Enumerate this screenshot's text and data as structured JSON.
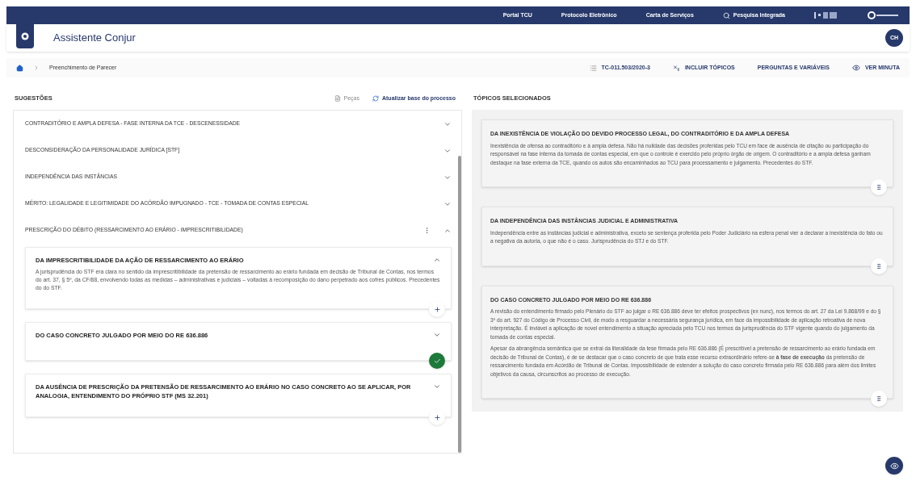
{
  "top_bar": {
    "links": [
      "Portal TCU",
      "Protocolo Eletrônico",
      "Carta de Serviços",
      "Pesquisa Integrada"
    ]
  },
  "header": {
    "title": "Assistente Conjur",
    "avatar": "CH"
  },
  "breadcrumb": {
    "items": [
      "Preenchimento de Parecer"
    ]
  },
  "toolbar": {
    "process": "TC-011.503/2020-3",
    "actions": [
      "INCLUIR TÓPICOS",
      "PERGUNTAS E VARIÁVEIS",
      "VER MINUTA"
    ]
  },
  "suggestions": {
    "title": "SUGESTÕES",
    "pieces": "Peças",
    "refresh": "Atualizar base do processo",
    "items": [
      {
        "label": "CONTRADITÓRIO E AMPLA DEFESA - FASE INTERNA DA TCE - DESCENESSIDADE",
        "expanded": false
      },
      {
        "label": "DESCONSIDERAÇÃO DA PERSONALIDADE JURÍDICA [STF]",
        "expanded": false
      },
      {
        "label": "INDEPENDÊNCIA DAS INSTÂNCIAS",
        "expanded": false
      },
      {
        "label": "MÉRITO: LEGALIDADE E LEGITIMIDADE DO ACÓRDÃO IMPUGNADO - TCE - TOMADA DE CONTAS ESPECIAL",
        "expanded": false
      },
      {
        "label": "PRESCRIÇÃO DO DÉBITO (RESSARCIMENTO AO ERÁRIO - IMPRESCRITIBILIDADE)",
        "expanded": true,
        "cards": [
          {
            "title": "DA IMPRESCRITIBILIDADE DA AÇÃO DE RESSARCIMENTO AO ERÁRIO",
            "expanded": true,
            "added": false,
            "text": "A jurisprudência do STF era clara no sentido da imprescritibilidade da pretensão de ressarcimento ao erário fundada em decisão de Tribunal de Contas, nos termos do art. 37, § 5º, da CF/88, envolvendo todas as medidas – administrativas e judiciais – voltadas à recomposição do dano perpetrado aos cofres públicos. Precedentes do do STF."
          },
          {
            "title": "DO CASO CONCRETO JULGADO POR MEIO DO RE 636.886",
            "expanded": false,
            "added": true
          },
          {
            "title": "DA AUSÊNCIA DE PRESCRIÇÃO DA PRETENSÃO DE RESSARCIMENTO AO ERÁRIO NO CASO CONCRETO AO SE APLICAR, POR ANALOGIA, ENTENDIMENTO DO PRÓPRIO STF (MS 32.201)",
            "expanded": false,
            "added": false
          }
        ]
      }
    ]
  },
  "selected_topics": {
    "title": "TÓPICOS SELECIONADOS",
    "cards": [
      {
        "title": "DA INEXISTÊNCIA DE VIOLAÇÃO DO DEVIDO PROCESSO LEGAL, DO CONTRADITÓRIO E DA AMPLA DEFESA",
        "paragraphs": [
          "Inexistência de ofensa ao contraditório e à ampla defesa. Não há nulidade das decisões proferidas pelo TCU em face de ausência de citação ou participação do responsável na fase interna da tomada de contas especial, em que o controle é exercido pelo próprio órgão de origem. O contraditório e a ampla defesa ganham destaque na fase externa da TCE, quando os autos são encaminhados ao TCU para processamento e julgamento. Precedentes do STF."
        ]
      },
      {
        "title": "DA INDEPENDÊNCIA DAS INSTÂNCIAS JUDICIAL E ADMINISTRATIVA",
        "paragraphs": [
          "Independência entre as instâncias judicial e administrativa, exceto se sentença proferida pelo Poder Judiciário na esfera penal vier a declarar a inexistência do fato ou a negativa da autoria, o que não é o caso. Jurisprudência do STJ e do STF."
        ]
      },
      {
        "title": "DO CASO CONCRETO JULGADO POR MEIO DO RE 636.886",
        "paragraphs": [
          "A revisão do entendimento firmado pelo Plenário do STF ao julgar o RE 636.886 deve ter efeitos prospectivos (ex nunc), nos termos do art. 27 da Lei 9.868/99 e do § 3º do art. 927 do Código de Processo Civil, de modo a resguardar a necessária segurança jurídica, em face da impossibilidade de aplicação retroativa de nova interpretação. É inviável a aplicação de novel entendimento a situação apreciada pelo TCU nos termos da jurisprudência do STF vigente quando do julgamento da tomada de contas especial.",
          "Apesar da abrangência semântica que se extrai da literalidade da tese firmada pelo RE 636.886 (É prescritível a pretensão de ressarcimento ao erário fundada em decisão de Tribunal de Contas), é de se destacar que o caso concreto de que trata esse recurso extraordinário refere-se **à fase de execução** da pretensão de ressarcimento fundada em Acórdão de Tribunal de Contas. Impossibilidade de estender a solução do caso concreto firmada pelo RE 636.886 para além dos limites objetivos da causa, circunscritos ao processo de execução."
        ]
      }
    ]
  }
}
